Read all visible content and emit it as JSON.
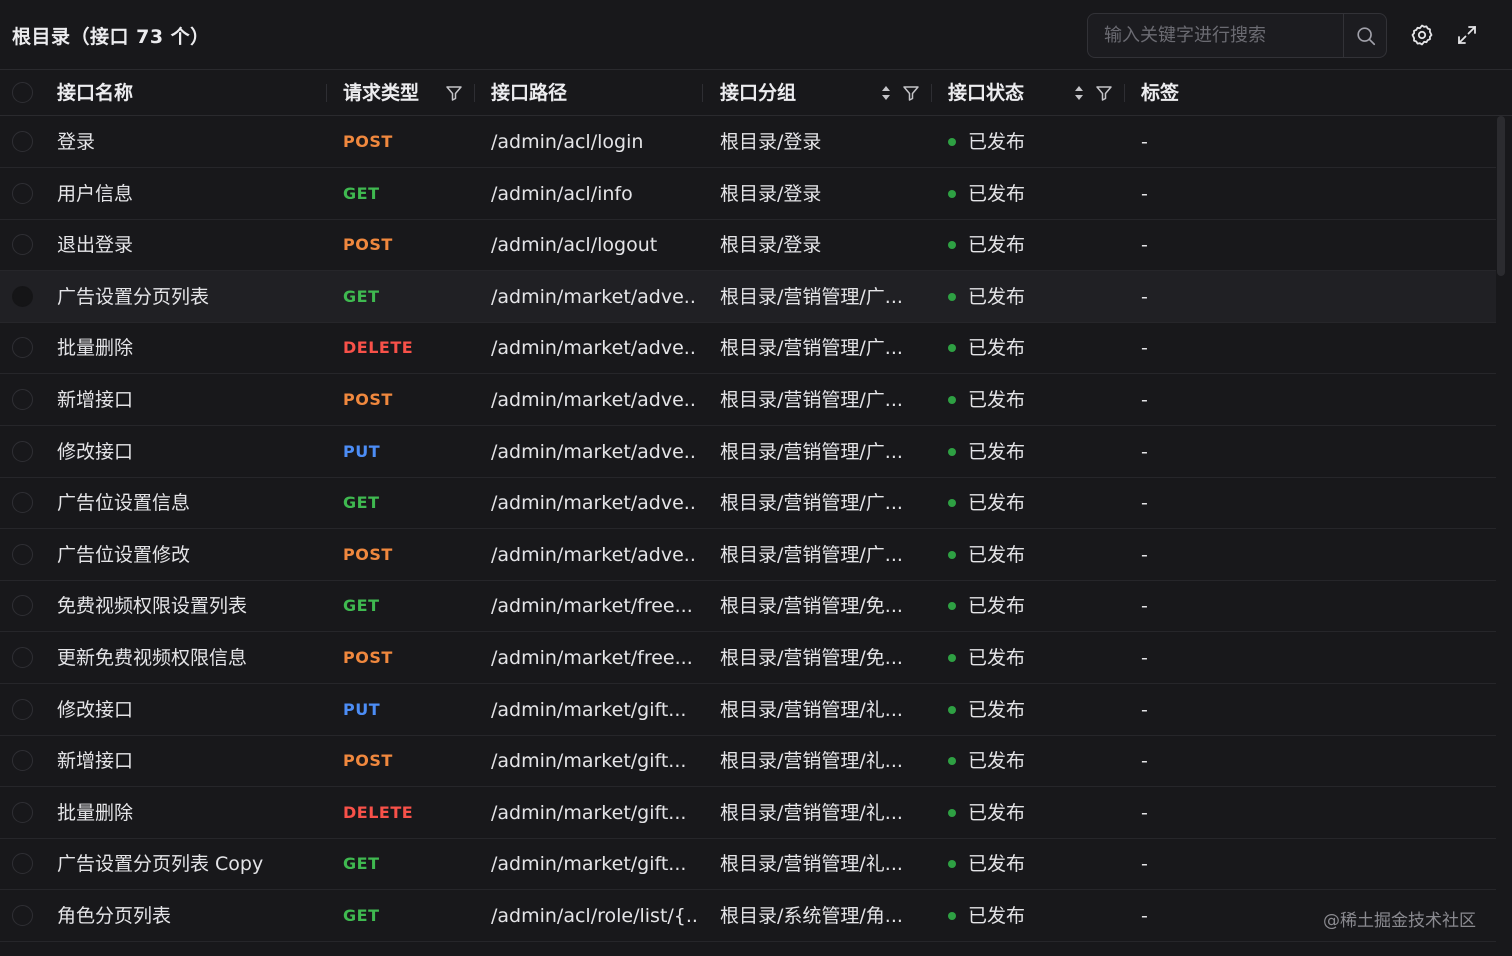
{
  "toolbar": {
    "title": "根目录（接口 73 个）",
    "search_placeholder": "输入关键字进行搜索",
    "search_icon": "search-icon",
    "settings_icon": "gear-icon",
    "fullscreen_icon": "expand-icon"
  },
  "table": {
    "columns": {
      "name": "接口名称",
      "method": "请求类型",
      "path": "接口路径",
      "group": "接口分组",
      "status": "接口状态",
      "tags": "标签"
    },
    "status_color": "#2ea043",
    "method_colors": {
      "POST": "#f0883e",
      "GET": "#3fb950",
      "PUT": "#4c8df6",
      "DELETE": "#f85149"
    },
    "rows": [
      {
        "name": "登录",
        "method": "POST",
        "path": "/admin/acl/login",
        "group": "根目录/登录",
        "status": "已发布",
        "tags": "-"
      },
      {
        "name": "用户信息",
        "method": "GET",
        "path": "/admin/acl/info",
        "group": "根目录/登录",
        "status": "已发布",
        "tags": "-"
      },
      {
        "name": "退出登录",
        "method": "POST",
        "path": "/admin/acl/logout",
        "group": "根目录/登录",
        "status": "已发布",
        "tags": "-"
      },
      {
        "name": "广告设置分页列表",
        "method": "GET",
        "path": "/admin/market/adve...",
        "group": "根目录/营销管理/广...",
        "status": "已发布",
        "tags": "-"
      },
      {
        "name": "批量删除",
        "method": "DELETE",
        "path": "/admin/market/adve...",
        "group": "根目录/营销管理/广...",
        "status": "已发布",
        "tags": "-"
      },
      {
        "name": "新增接口",
        "method": "POST",
        "path": "/admin/market/adve...",
        "group": "根目录/营销管理/广...",
        "status": "已发布",
        "tags": "-"
      },
      {
        "name": "修改接口",
        "method": "PUT",
        "path": "/admin/market/adve...",
        "group": "根目录/营销管理/广...",
        "status": "已发布",
        "tags": "-"
      },
      {
        "name": "广告位设置信息",
        "method": "GET",
        "path": "/admin/market/adve...",
        "group": "根目录/营销管理/广...",
        "status": "已发布",
        "tags": "-"
      },
      {
        "name": "广告位设置修改",
        "method": "POST",
        "path": "/admin/market/adve...",
        "group": "根目录/营销管理/广...",
        "status": "已发布",
        "tags": "-"
      },
      {
        "name": "免费视频权限设置列表",
        "method": "GET",
        "path": "/admin/market/free...",
        "group": "根目录/营销管理/免...",
        "status": "已发布",
        "tags": "-"
      },
      {
        "name": "更新免费视频权限信息",
        "method": "POST",
        "path": "/admin/market/free...",
        "group": "根目录/营销管理/免...",
        "status": "已发布",
        "tags": "-"
      },
      {
        "name": "修改接口",
        "method": "PUT",
        "path": "/admin/market/gift...",
        "group": "根目录/营销管理/礼...",
        "status": "已发布",
        "tags": "-"
      },
      {
        "name": "新增接口",
        "method": "POST",
        "path": "/admin/market/gift...",
        "group": "根目录/营销管理/礼...",
        "status": "已发布",
        "tags": "-"
      },
      {
        "name": "批量删除",
        "method": "DELETE",
        "path": "/admin/market/gift...",
        "group": "根目录/营销管理/礼...",
        "status": "已发布",
        "tags": "-"
      },
      {
        "name": "广告设置分页列表 Copy",
        "method": "GET",
        "path": "/admin/market/gift...",
        "group": "根目录/营销管理/礼...",
        "status": "已发布",
        "tags": "-"
      },
      {
        "name": "角色分页列表",
        "method": "GET",
        "path": "/admin/acl/role/list/{...",
        "group": "根目录/系统管理/角...",
        "status": "已发布",
        "tags": "-"
      }
    ]
  },
  "watermark": "@稀土掘金技术社区"
}
